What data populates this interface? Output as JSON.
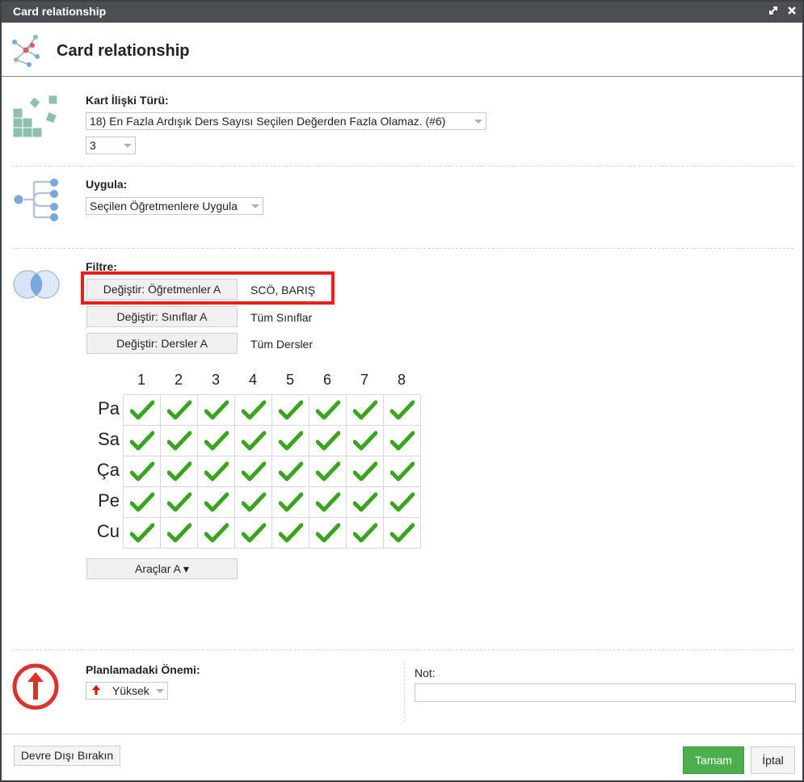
{
  "window": {
    "title": "Card relationship",
    "maximize_icon": "maximize-icon",
    "close_icon": "close-icon"
  },
  "header": {
    "title": "Card relationship"
  },
  "relation": {
    "label": "Kart İlişki Türü:",
    "type_value": "18) En Fazla Ardışık Ders Sayısı Seçilen Değerden Fazla Olamaz. (#6)",
    "count_value": "3"
  },
  "apply": {
    "label": "Uygula:",
    "value": "Seçilen Öğretmenlere Uygula"
  },
  "filter": {
    "label": "Filtre:",
    "rows": [
      {
        "button": "Değiştir: Öğretmenler A",
        "value": "SCÖ, BARIŞ"
      },
      {
        "button": "Değiştir: Sınıflar A",
        "value": "Tüm Sınıflar"
      },
      {
        "button": "Değiştir: Dersler A",
        "value": "Tüm Dersler"
      }
    ]
  },
  "grid": {
    "columns": [
      "1",
      "2",
      "3",
      "4",
      "5",
      "6",
      "7",
      "8"
    ],
    "rows": [
      "Pa",
      "Sa",
      "Ça",
      "Pe",
      "Cu"
    ],
    "cell_state": "checked",
    "check_color": "#3aa31f"
  },
  "tools_button": "Araçlar A ▾",
  "priority": {
    "label": "Planlamadaki Önemi:",
    "value": "Yüksek",
    "arrow_color": "#e00000"
  },
  "note": {
    "label": "Not:",
    "value": ""
  },
  "footer": {
    "disable": "Devre Dışı Bırakın",
    "ok": "Tamam",
    "cancel": "İptal"
  },
  "colors": {
    "titlebar": "#4b4f54",
    "ok_button": "#4cae4c",
    "highlight_box": "#ee1c1c",
    "icon_teal": "#8fbfb0",
    "icon_blue": "#7aa8dd"
  }
}
